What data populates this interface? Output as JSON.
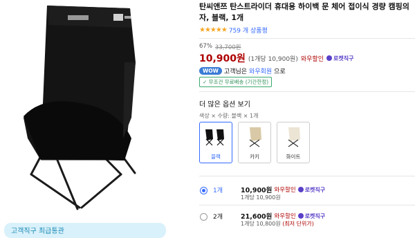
{
  "product": {
    "title": "탄씨앤쯔 탄스트라이더 휴대용 하이백 문 체어 접이식 경량 캠핑의자, 블랙, 1개",
    "rating_stars": "★★★★★",
    "rating_count": "759 개 상품평"
  },
  "pricing": {
    "discount_pct": "67%",
    "original_price": "33,700원",
    "price": "10,900원",
    "unit_price": "(1개당 10,900원)",
    "wow_label": "와우할인",
    "rocket_label": "로켓직구"
  },
  "member": {
    "badge": "WOW",
    "text_prefix": "고객님은",
    "link": "와우회원",
    "text_suffix": "으로"
  },
  "shipping": {
    "chip": "✓ 무조건 무료배송 (기간한정)"
  },
  "options": {
    "heading": "더 많은 옵션 보기",
    "selected_summary": "색상 × 수량: 블랙 × 1개",
    "items": [
      {
        "label": "블랙",
        "selected": true
      },
      {
        "label": "카키",
        "selected": false
      },
      {
        "label": "화이트",
        "selected": false
      }
    ]
  },
  "quantities": [
    {
      "label": "1개",
      "price": "10,900원",
      "wow": "와우할인",
      "rocket": "로켓직구",
      "unit": "1개당 10,900원",
      "best": ""
    },
    {
      "label": "2개",
      "price": "21,600원",
      "wow": "와우할인",
      "rocket": "로켓직구",
      "unit": "1개당 10,800원",
      "best": "(최저 단위가)"
    }
  ],
  "banner": {
    "text": "고객직구 최급통관"
  },
  "colors": {
    "accent": "#346aff",
    "price_red": "#ae0000",
    "rocket_purple": "#5a3fc8"
  }
}
